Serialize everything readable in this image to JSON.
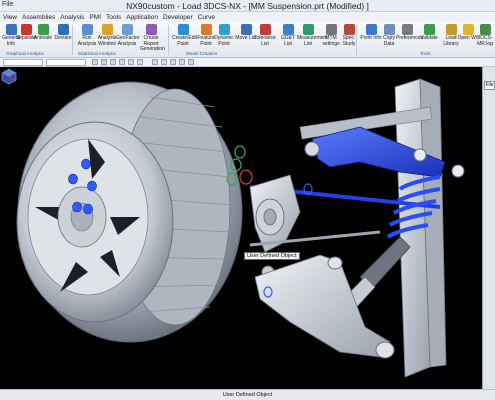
{
  "window": {
    "title": "NX90custom - Load 3DCS-NX - [MM Suspension.prt (Modified) ]",
    "menu_button": "File"
  },
  "menubar": [
    "View",
    "Assemblies",
    "Analysis",
    "PMI",
    "Tools",
    "Application",
    "Developer",
    "Curve"
  ],
  "ribbon": {
    "tools": [
      {
        "id": "general",
        "label": "General Info",
        "color": "#3a6fbd"
      },
      {
        "id": "separate",
        "label": "Separate",
        "color": "#cc3333"
      },
      {
        "id": "animate",
        "label": "Animate",
        "color": "#3b9c4a"
      },
      {
        "id": "deviate",
        "label": "Deviate",
        "color": "#2f6fb8"
      },
      {
        "id": "run-analysis",
        "label": "Run Analysis",
        "color": "#5a8fcf"
      },
      {
        "id": "analysis-window",
        "label": "Analysis Window",
        "color": "#d9a326"
      },
      {
        "id": "geofactor",
        "label": "GeoFactor Analysis",
        "color": "#6a9bd3"
      },
      {
        "id": "report",
        "label": "Create Report Generation",
        "color": "#8d5bb5"
      },
      {
        "id": "create-edit-point",
        "label": "Create/Edit Point",
        "color": "#2b8fd6"
      },
      {
        "id": "feature-point",
        "label": "Feature Point",
        "color": "#e07a22"
      },
      {
        "id": "dynamic-point",
        "label": "Dynamic Point",
        "color": "#35a0c9"
      },
      {
        "id": "move-list",
        "label": "Move List",
        "color": "#3d6fb6"
      },
      {
        "id": "tolerance-list",
        "label": "Tolerance List",
        "color": "#c23a3a"
      },
      {
        "id": "gdt-list",
        "label": "GD&T List",
        "color": "#3d7fc4"
      },
      {
        "id": "measurement-list",
        "label": "Measurement List",
        "color": "#2e9a6d"
      },
      {
        "id": "mtm-settings",
        "label": "MTM settings",
        "color": "#777777"
      },
      {
        "id": "spec-study",
        "label": "Spec. Study",
        "color": "#b5483a"
      },
      {
        "id": "point-info",
        "label": "Point Info",
        "color": "#3a78c2"
      },
      {
        "id": "copy-data",
        "label": "Copy Data",
        "color": "#6d8fb8"
      },
      {
        "id": "preferences",
        "label": "Preferences",
        "color": "#7a7a7a"
      },
      {
        "id": "validate",
        "label": "Validate",
        "color": "#3d9b4b"
      },
      {
        "id": "load-library",
        "label": "Load Library",
        "color": "#c69a2a"
      },
      {
        "id": "open-wrl",
        "label": "Open Wrl",
        "color": "#e0b42a"
      },
      {
        "id": "3dcs-mr",
        "label": "3DCS-MR log",
        "color": "#4a8a4a"
      }
    ],
    "groups": [
      "Graphical Analysis",
      "Statistical Analysis",
      "Model Creation",
      "Tools"
    ]
  },
  "viewport": {
    "tooltip": "User Defined Object"
  },
  "right_panel": {
    "tab": "File"
  },
  "statusbar": {
    "text": "User Defined Object"
  }
}
